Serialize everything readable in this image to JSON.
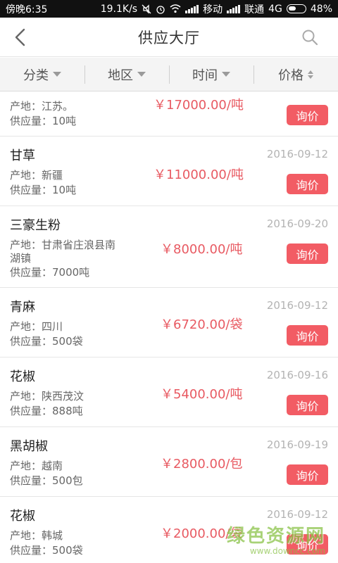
{
  "status_bar": {
    "time": "傍晚6:35",
    "speed": "19.1K/s",
    "carrier1": "移动",
    "carrier2": "联通",
    "network": "4G",
    "battery": "48%"
  },
  "header": {
    "title": "供应大厅",
    "back_icon": "chevron-left-icon",
    "search_icon": "search-icon"
  },
  "filters": [
    {
      "label": "分类",
      "icon": "triangle-down-icon"
    },
    {
      "label": "地区",
      "icon": "triangle-down-icon"
    },
    {
      "label": "时间",
      "icon": "triangle-down-icon"
    },
    {
      "label": "价格",
      "icon": "sort-icon"
    }
  ],
  "items": [
    {
      "name": "",
      "date": "",
      "origin": "产地：江苏。",
      "origin2": "",
      "supply": "供应量：10吨",
      "price": "￥17000.00/吨",
      "action": "询价"
    },
    {
      "name": "甘草",
      "date": "2016-09-12",
      "origin": "产地：新疆",
      "origin2": "",
      "supply": "供应量：10吨",
      "price": "￥11000.00/吨",
      "action": "询价"
    },
    {
      "name": "三豪生粉",
      "date": "2016-09-20",
      "origin": "产地：甘肃省庄浪县南",
      "origin2": "湖镇",
      "supply": "供应量：7000吨",
      "price": "￥8000.00/吨",
      "action": "询价"
    },
    {
      "name": "青麻",
      "date": "2016-09-12",
      "origin": "产地：四川",
      "origin2": "",
      "supply": "供应量：500袋",
      "price": "￥6720.00/袋",
      "action": "询价"
    },
    {
      "name": "花椒",
      "date": "2016-09-16",
      "origin": "产地：陕西茂汶",
      "origin2": "",
      "supply": "供应量：888吨",
      "price": "￥5400.00/吨",
      "action": "询价"
    },
    {
      "name": "黑胡椒",
      "date": "2016-09-19",
      "origin": "产地：越南",
      "origin2": "",
      "supply": "供应量：500包",
      "price": "￥2800.00/包",
      "action": "询价"
    },
    {
      "name": "花椒",
      "date": "2016-09-12",
      "origin": "产地：韩城",
      "origin2": "",
      "supply": "供应量：500袋",
      "price": "￥2000.00/袋",
      "action": "询价"
    }
  ],
  "watermark": {
    "main": "绿色资源网",
    "sub": "www.downcc.com"
  },
  "colors": {
    "accent": "#f25c64",
    "price": "#e85a62",
    "date": "#b3b3b3"
  }
}
